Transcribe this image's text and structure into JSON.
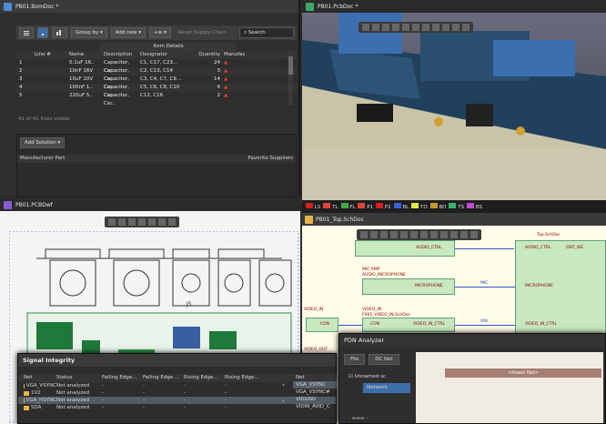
{
  "bom": {
    "title": "PB01.BomDoc *",
    "toolbar": {
      "group_by": "Group by",
      "add_new": "Add new",
      "reset": "Reset Supply Chain",
      "search": "Search"
    },
    "item_details": "Item Details",
    "columns": [
      "Line #",
      "Name",
      "Description",
      "Designator",
      "Quantity",
      "Manufac"
    ],
    "rows": [
      {
        "line": "1",
        "name": "0.1uF 16..",
        "desc": "Capacitor, Cer..",
        "des": "C1, C17, C23...",
        "qty": "24"
      },
      {
        "line": "2",
        "name": "10nF 16V",
        "desc": "Capacitor, Cer..",
        "des": "C2, C13, C14",
        "qty": "3"
      },
      {
        "line": "3",
        "name": "10uF 10V",
        "desc": "Capacitor, Cer..",
        "des": "C3, C4, C7, C9...",
        "qty": "14"
      },
      {
        "line": "4",
        "name": "100nF 1..",
        "desc": "Capacitor, Cer..",
        "des": "C5, C6, C8, C10",
        "qty": "4"
      },
      {
        "line": "5",
        "name": "220uF 5..",
        "desc": "Capacitor, Cer..",
        "des": "C12, C16",
        "qty": "2"
      }
    ],
    "lines_visible": "41 of 41 lines visible",
    "add_solution": "Add Solution",
    "manufacturer_part": "Manufacturer Part",
    "favorite_suppliers": "Favorite Suppliers"
  },
  "pcb3d": {
    "title": "PB01.PcbDoc *"
  },
  "pcbdraw": {
    "title": "PB01.PCBDwf",
    "label_j5": "J5"
  },
  "layers": [
    {
      "name": "LS",
      "color": "#d62020"
    },
    {
      "name": "TL",
      "color": "#e0453a"
    },
    {
      "name": "FL",
      "color": "#44aa44"
    },
    {
      "name": "P1",
      "color": "#e0453a"
    },
    {
      "name": "P2",
      "color": "#d62020"
    },
    {
      "name": "BL",
      "color": "#3a5fdc"
    },
    {
      "name": "TO",
      "color": "#e8e83a"
    },
    {
      "name": "BO",
      "color": "#c89a2a"
    },
    {
      "name": "TS",
      "color": "#3ab070"
    },
    {
      "name": "BS",
      "color": "#c04ad0"
    }
  ],
  "schematic": {
    "title": "PB01_Top.SchDoc",
    "labels": {
      "top_schdoc": "Top.SchDoc",
      "audio_ctrl": "AUDIO_CTRL",
      "audio_ctrl_right": "AUDIO_CTRL",
      "ont_wr": "ONT_WE",
      "mic_amp": "MIC AMP",
      "audio_mic": "AUDIO_MICROPHONE",
      "microphone": "MICROPHONE",
      "mic_net": "MIC",
      "microphone_right": "MICROPHONE",
      "video_in_left": "VIDEO_IN",
      "video_in": "VIDEO_IN",
      "video_in_sch": "F001_VIDEO_IN.SchDoc",
      "con_left": "CON",
      "con": "CON",
      "video_in_ctrl": "VIDEO_IN_CTRL",
      "vin": "VIN",
      "video_in_ctrl_right": "VIDEO_IN_CTRL",
      "video_out": "VIDEO_OUT"
    }
  },
  "signal_integrity": {
    "title": "Signal Integrity",
    "columns": [
      "Net",
      "Status",
      "Falling Edge...",
      "Falling Edge ...",
      "Rising Edge...",
      "Rising Edge..."
    ],
    "rows": [
      {
        "net": "VGA_VSYNC",
        "status": "Not analyzed",
        "selected": false
      },
      {
        "net": "1V2",
        "status": "Not analyzed",
        "selected": false
      },
      {
        "net": "VGA_HSYNC",
        "status": "Not analyzed",
        "selected": true
      },
      {
        "net": "SDA",
        "status": "Not analyzed",
        "selected": false
      }
    ],
    "dash": "-",
    "right_header": "Net",
    "right_rows": [
      "VGA_VSYNC",
      "VGA_VSYNC#",
      "VIDGND",
      "VIDIN_AVID_C"
    ]
  },
  "pdn": {
    "title": "PDN Analyzer",
    "file": "File",
    "dc_net": "DC Net",
    "unnamed": "Unnamed sc",
    "network": "Network",
    "power_net": "<Power Net>"
  }
}
